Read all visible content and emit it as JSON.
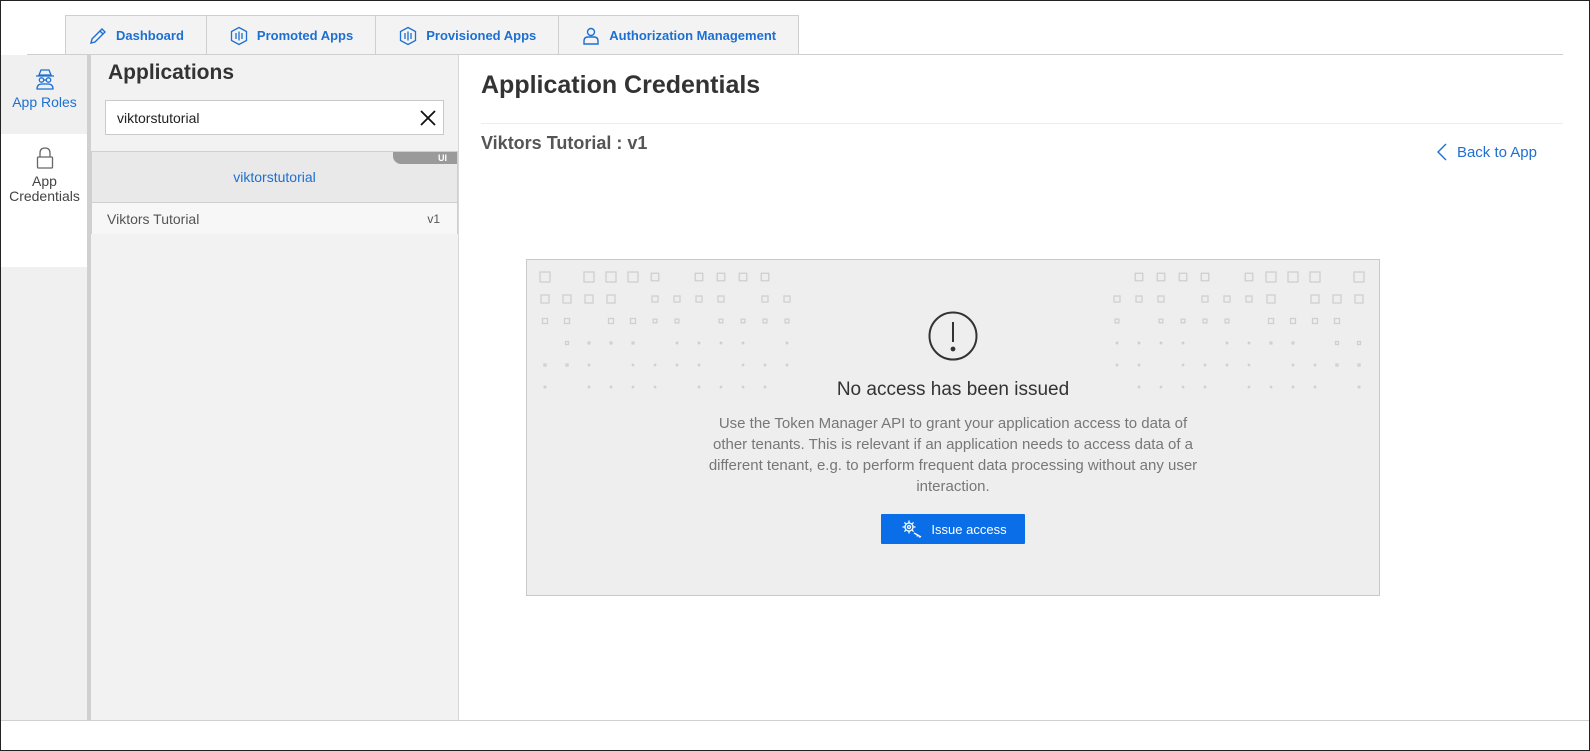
{
  "tabs": [
    {
      "label": "Dashboard",
      "icon": "pencil-icon"
    },
    {
      "label": "Promoted Apps",
      "icon": "hexagon-app-icon"
    },
    {
      "label": "Provisioned Apps",
      "icon": "hexagon-app-icon"
    },
    {
      "label": "Authorization Management",
      "icon": "user-icon"
    }
  ],
  "rail": {
    "items": [
      {
        "label": "App Roles",
        "icon": "incognito-user-icon"
      },
      {
        "label_line1": "App",
        "label_line2": "Credentials",
        "icon": "lock-icon"
      }
    ]
  },
  "applications": {
    "title": "Applications",
    "search": {
      "value": "viktorstutorial",
      "placeholder": ""
    },
    "items": [
      {
        "name": "viktorstutorial",
        "badge": "UI",
        "version_title": "Viktors Tutorial",
        "version": "v1"
      }
    ]
  },
  "main": {
    "title": "Application Credentials",
    "subtitle": "Viktors Tutorial : v1",
    "back_label": "Back to App",
    "empty_state": {
      "heading": "No access has been issued",
      "description": "Use the Token Manager API to grant your application access to data of other tenants. This is relevant if an application needs to access data of a different tenant, e.g. to perform frequent data processing without any user interaction.",
      "button_label": "Issue access"
    }
  },
  "colors": {
    "accent": "#1d6fd1",
    "primary_button": "#0a6ee8",
    "panel_bg": "#f2f2f2"
  }
}
